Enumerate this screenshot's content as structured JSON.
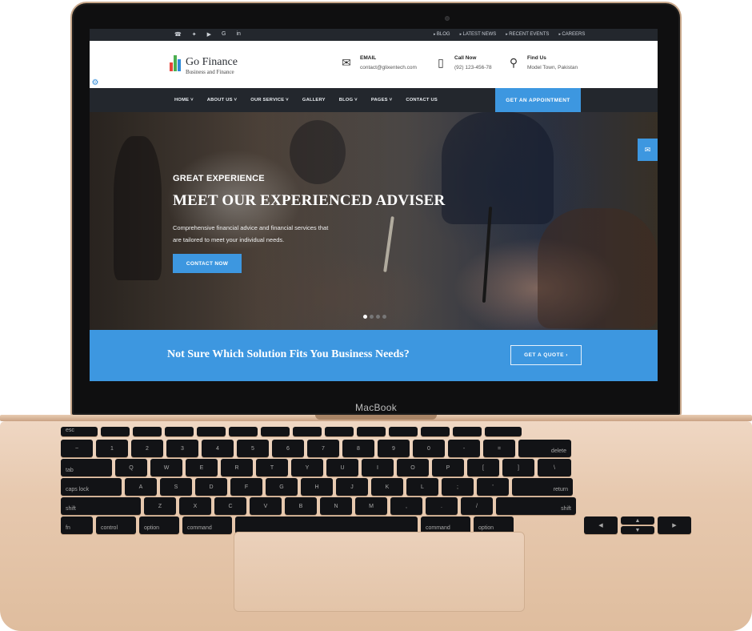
{
  "device": {
    "brand_label": "MacBook"
  },
  "topbar": {
    "social_icons": [
      "skype-icon",
      "twitter-icon",
      "youtube-icon",
      "google-plus-icon",
      "linkedin-icon"
    ],
    "links": [
      "BLOG",
      "LATEST NEWS",
      "RECENT EVENTS",
      "CAREERS"
    ]
  },
  "header": {
    "logo_title": "Go Finance",
    "logo_subtitle": "Business and Finance",
    "email_label": "EMAIL",
    "email_value": "contact@glixentech.com",
    "call_label": "Call Now",
    "call_value": "(92) 123-456-78",
    "find_label": "Find Us",
    "find_value": "Model Town, Pakistan"
  },
  "nav": {
    "items": [
      "HOME",
      "ABOUT US",
      "OUR SERVICE",
      "GALLERY",
      "BLOG",
      "PAGES",
      "CONTACT US"
    ],
    "appointment_label": "GET AN APPOINTMENT"
  },
  "hero": {
    "eyebrow": "GREAT EXPERIENCE",
    "title": "MEET OUR EXPERIENCED ADVISER",
    "text": "Comprehensive financial advice and financial services that are tailored to meet your individual needs.",
    "button_label": "CONTACT NOW",
    "active_slide": 1,
    "slide_count": 4
  },
  "cta": {
    "text": "Not Sure Which Solution Fits You Business Needs?",
    "button_label": "GET A QUOTE ›"
  },
  "keyboard": {
    "row0": [
      "esc",
      "",
      "",
      "",
      "",
      "",
      "",
      "",
      "",
      "",
      "",
      "",
      "",
      ""
    ],
    "row1": [
      "~",
      "1",
      "2",
      "3",
      "4",
      "5",
      "6",
      "7",
      "8",
      "9",
      "0",
      "-",
      "=",
      "delete"
    ],
    "row2": [
      "tab",
      "Q",
      "W",
      "E",
      "R",
      "T",
      "Y",
      "U",
      "I",
      "O",
      "P",
      "[",
      "]",
      "\\"
    ],
    "row3": [
      "caps lock",
      "A",
      "S",
      "D",
      "F",
      "G",
      "H",
      "J",
      "K",
      "L",
      ";",
      "'",
      "return"
    ],
    "row4": [
      "shift",
      "Z",
      "X",
      "C",
      "V",
      "B",
      "N",
      "M",
      ",",
      ".",
      "/",
      "shift"
    ],
    "row5": [
      "fn",
      "control",
      "option",
      "command",
      "",
      "command",
      "option"
    ]
  },
  "colors": {
    "accent": "#3d97e0",
    "dark_bar": "#23272d",
    "laptop_gold": "#e7c9af"
  }
}
